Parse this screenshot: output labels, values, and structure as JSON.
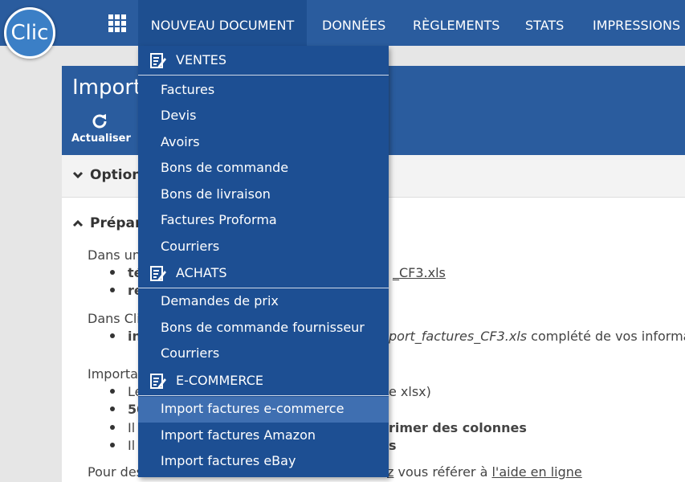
{
  "logo": {
    "text": "Clic"
  },
  "nav": {
    "apps_icon": "grid-icon",
    "items": [
      "NOUVEAU DOCUMENT",
      "DONNÉES",
      "RÈGLEMENTS",
      "STATS",
      "IMPRESSIONS"
    ],
    "active": "NOUVEAU DOCUMENT"
  },
  "page": {
    "title": "Importa",
    "refresh_label": "Actualiser",
    "section_options": "Option",
    "section_prepare": "Prépar",
    "line1": "Dans un",
    "bullet1a": "té",
    "bullet1a_link": "_CF3.xls",
    "bullet1b": "re",
    "line2": "Dans Cli",
    "bullet2a": "in",
    "bullet2a_file": "port_factures_CF3.xls",
    "bullet2a_rest": " complété de vos information",
    "line3": "Importa",
    "bullet3a": "Le",
    "bullet3a_rest": "e xlsx)",
    "bullet3b": "50",
    "bullet3c": "Il",
    "bullet3c_rest": "rimer des colonnes",
    "bullet3d": "Il",
    "bullet3d_rest": "s",
    "line4": "Pour des",
    "line4_mid": "z",
    "line4_rest": " vous référer à ",
    "line4_link": "l'aide en ligne"
  },
  "menu": {
    "groups": [
      {
        "header": "VENTES",
        "icon": "document-edit-icon",
        "items": [
          "Factures",
          "Devis",
          "Avoirs",
          "Bons de commande",
          "Bons de livraison",
          "Factures Proforma",
          "Courriers"
        ]
      },
      {
        "header": "ACHATS",
        "icon": "document-edit-icon",
        "items": [
          "Demandes de prix",
          "Bons de commande fournisseur",
          "Courriers"
        ]
      },
      {
        "header": "E-COMMERCE",
        "icon": "document-edit-icon",
        "items": [
          "Import factures e-commerce",
          "Import factures Amazon",
          "Import factures eBay"
        ]
      }
    ],
    "highlighted": "Import factures e-commerce"
  }
}
